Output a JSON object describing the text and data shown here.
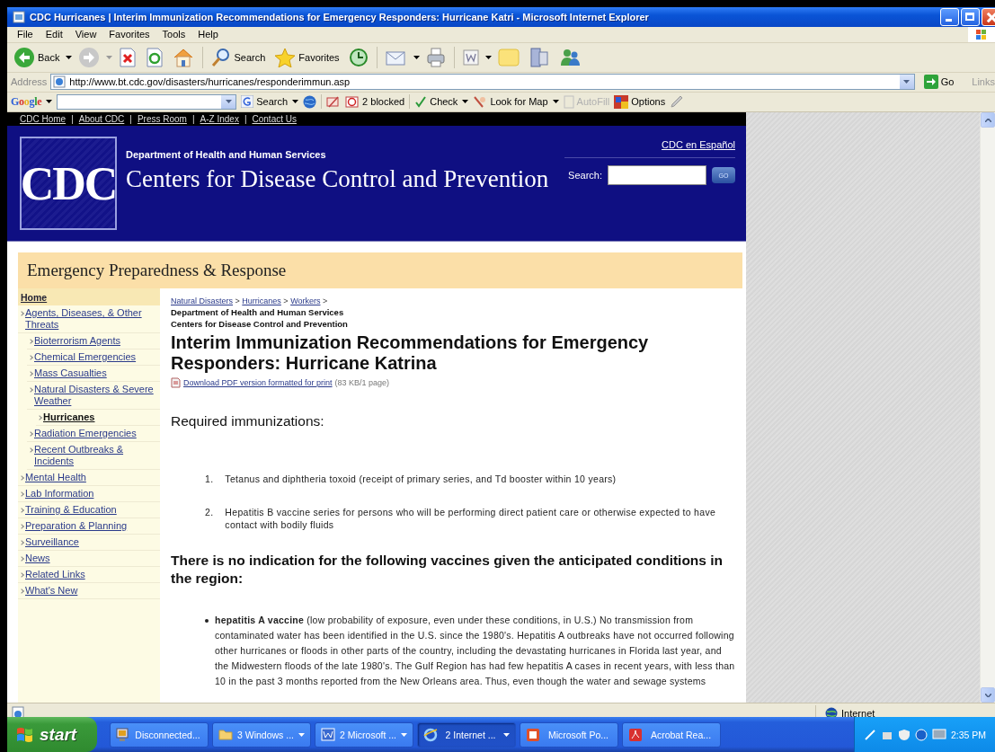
{
  "window": {
    "title": "CDC Hurricanes | Interim Immunization Recommendations for Emergency Responders: Hurricane Katri - Microsoft Internet Explorer"
  },
  "menu": [
    "File",
    "Edit",
    "View",
    "Favorites",
    "Tools",
    "Help"
  ],
  "toolbar": {
    "back": "Back",
    "search": "Search",
    "favorites": "Favorites"
  },
  "address": {
    "label": "Address",
    "url": "http://www.bt.cdc.gov/disasters/hurricanes/responderimmun.asp",
    "go": "Go",
    "links": "Links"
  },
  "google_bar": {
    "logo": "Google",
    "search": "Search",
    "blocked": "2 blocked",
    "check": "Check",
    "map": "Look for Map",
    "autofill": {
      "label": "AutoFill",
      "disabled": true
    },
    "options": "Options"
  },
  "page": {
    "top_links": {
      "items": [
        "CDC Home",
        "About CDC",
        "Press Room",
        "A-Z Index",
        "Contact Us"
      ],
      "separator": "|"
    },
    "header": {
      "logo": "CDC",
      "department": "Department of Health and Human Services",
      "agency": "Centers for Disease Control and Prevention",
      "spanish_link": "CDC en Español",
      "search_label": "Search:",
      "go": "GO"
    },
    "section_title": "Emergency Preparedness & Response",
    "nav": {
      "home": "Home",
      "items": [
        {
          "label": "Agents, Diseases, & Other Threats",
          "selected": false,
          "children": [
            {
              "label": "Bioterrorism Agents",
              "selected": false
            },
            {
              "label": "Chemical Emergencies",
              "selected": false
            },
            {
              "label": "Mass Casualties",
              "selected": false
            },
            {
              "label": "Natural Disasters & Severe Weather",
              "selected": false,
              "children": [
                {
                  "label": "Hurricanes",
                  "selected": true
                }
              ]
            },
            {
              "label": "Radiation Emergencies",
              "selected": false
            },
            {
              "label": "Recent Outbreaks & Incidents",
              "selected": false
            }
          ]
        },
        {
          "label": "Mental Health",
          "selected": false
        },
        {
          "label": "Lab Information",
          "selected": false
        },
        {
          "label": "Training & Education",
          "selected": false
        },
        {
          "label": "Preparation & Planning",
          "selected": false
        },
        {
          "label": "Surveillance",
          "selected": false
        },
        {
          "label": "News",
          "selected": false
        },
        {
          "label": "Related Links",
          "selected": false
        },
        {
          "label": "What's New",
          "selected": false
        }
      ]
    },
    "breadcrumb": {
      "items": [
        "Natural Disasters",
        "Hurricanes",
        "Workers"
      ],
      "separator": ">"
    },
    "source_lines": [
      "Department of Health and Human Services",
      "Centers for Disease Control and Prevention"
    ],
    "title": "Interim Immunization Recommendations for Emergency Responders: Hurricane Katrina",
    "pdf": {
      "link": "Download PDF version formatted for print",
      "size": "(83 KB/1 page)"
    },
    "required_heading": "Required immunizations:",
    "required": [
      {
        "number": "1.",
        "text": "Tetanus and diphtheria toxoid (receipt of primary series, and Td booster within 10 years)"
      },
      {
        "number": "2.",
        "text": "Hepatitis B vaccine series for persons who will be performing direct patient care or otherwise expected to have contact with bodily fluids"
      }
    ],
    "no_indication_heading": "There is no indication for the following vaccines given the anticipated conditions in the region:",
    "no_indication": [
      "**hepatitis A vaccine** (low probability of exposure, even under these conditions, in U.S.) No transmission from contaminated water has been identified in the U.S. since the 1980's. Hepatitis A outbreaks have not occurred following other hurricanes or floods in other parts of the country, including the devastating hurricanes in Florida last year, and the Midwestern floods of the late 1980's. The Gulf Region has had few hepatitis A cases in recent years, with less than 10 in the past 3 months reported from the New Orleans area. Thus, even though the water and sewage systems"
    ]
  },
  "status_bar": {
    "zone": "Internet"
  },
  "taskbar": {
    "start": "start",
    "items": [
      {
        "label": "Disconnected...",
        "kind": "remote",
        "grouped": false,
        "selected": false
      },
      {
        "label": "3 Windows ...",
        "kind": "folder",
        "grouped": true,
        "selected": false
      },
      {
        "label": "2 Microsoft ...",
        "kind": "doc",
        "grouped": true,
        "selected": false
      },
      {
        "label": "2 Internet ...",
        "kind": "browser",
        "grouped": true,
        "selected": true
      },
      {
        "label": "Microsoft Po...",
        "kind": "slides",
        "grouped": false,
        "selected": false
      },
      {
        "label": "Acrobat Rea...",
        "kind": "pdf",
        "grouped": false,
        "selected": false
      }
    ],
    "clock": "2:35 PM"
  }
}
